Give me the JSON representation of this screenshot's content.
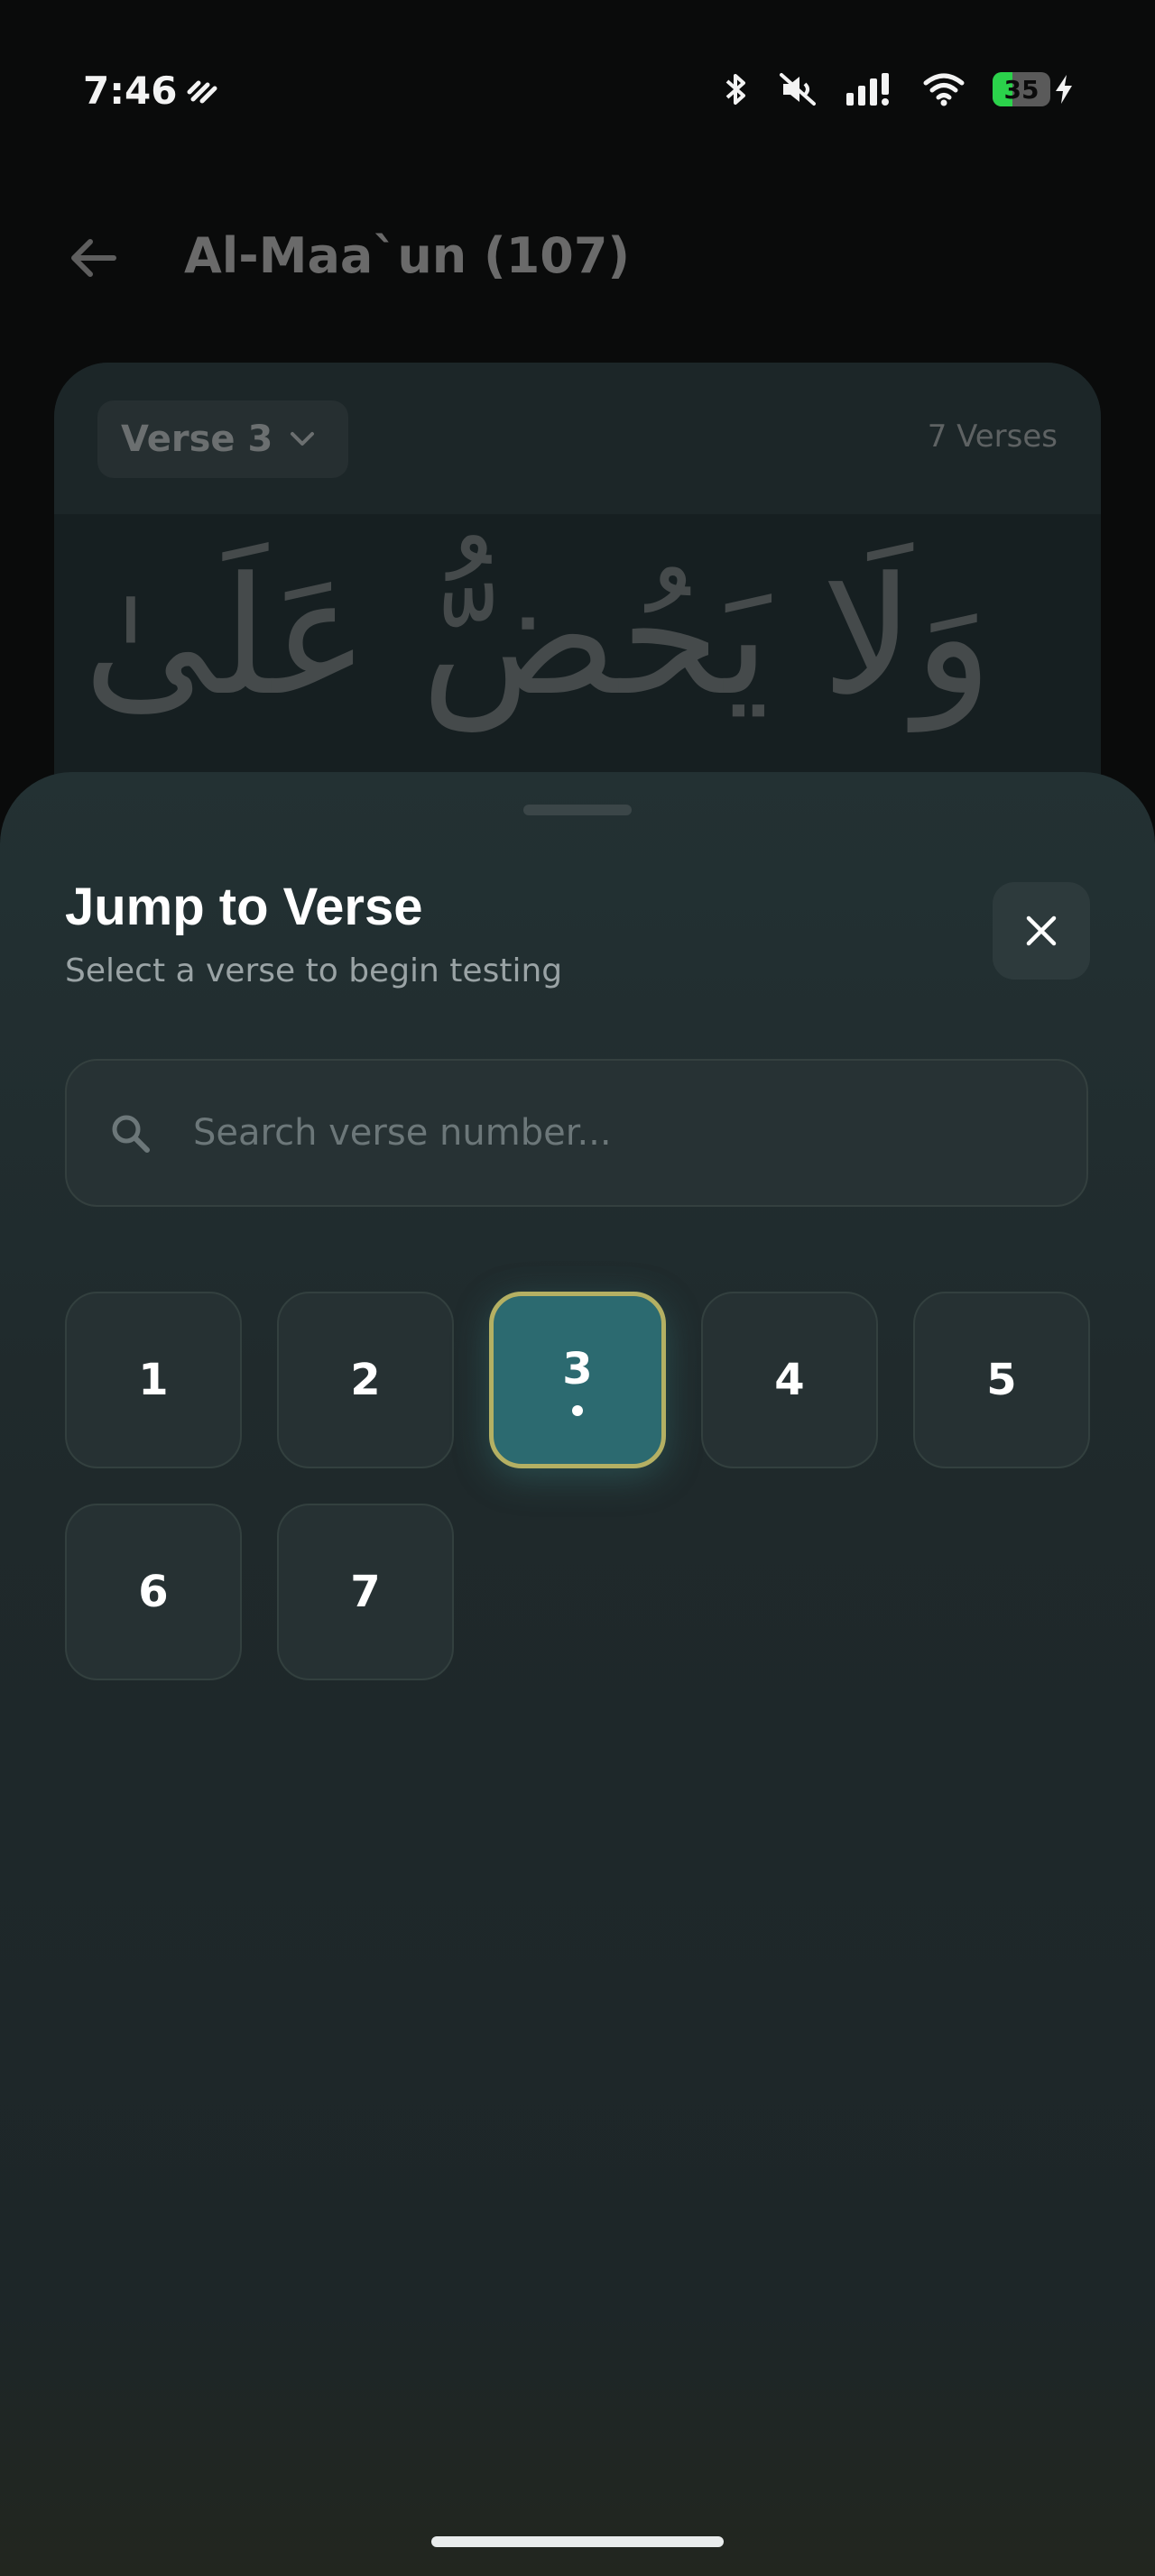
{
  "status_bar": {
    "time": "7:46",
    "battery_level": "35",
    "battery_fraction": 0.35,
    "icons": [
      "activity-icon",
      "bluetooth-icon",
      "mute-icon",
      "signal-icon",
      "wifi-icon",
      "battery-icon",
      "charging-icon"
    ]
  },
  "page": {
    "title": "Al-Maa`un (107)",
    "verse_selector_label": "Verse 3",
    "verse_count": "7 Verses",
    "arabic_preview": "وَلَا يَحُضُّ عَلَىٰ طَعَامِ"
  },
  "sheet": {
    "title": "Jump to Verse",
    "subtitle": "Select a verse to begin testing",
    "search_placeholder": "Search verse number...",
    "search_value": "",
    "verses": [
      "1",
      "2",
      "3",
      "4",
      "5",
      "6",
      "7"
    ],
    "selected_verse": "3"
  },
  "colors": {
    "accent": "#2c6a70",
    "selected_border": "#b4b063",
    "battery": "#2bd24b"
  }
}
